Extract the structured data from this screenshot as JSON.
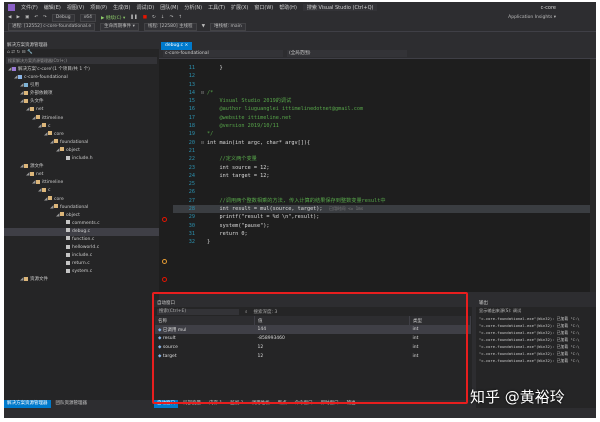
{
  "menubar": {
    "items": [
      "文件(F)",
      "编辑(E)",
      "视图(V)",
      "项目(P)",
      "生成(B)",
      "调试(D)",
      "团队(M)",
      "分析(N)",
      "工具(T)",
      "扩展(X)",
      "窗口(W)",
      "帮助(H)",
      "搜索 Visual Studio (Ctrl+Q)"
    ],
    "title": "c-core"
  },
  "toolbar": {
    "mode": "Debug",
    "platform": "x64",
    "start_label": "▶ 继续(C) ▾",
    "right_label": "Application Insights ▾",
    "process": "进程: [12552] c-core-foundational.e",
    "lifecycle": "生命周期事件 ▾",
    "thread": "线程: [22580] 主线程",
    "stack": "堆栈帧: main"
  },
  "solution_explorer": {
    "title": "解决方案资源管理器",
    "search_placeholder": "搜索解决方案资源管理器(Ctrl+;)",
    "tree": [
      {
        "label": "解决方案'c-core'(1 个项目/共 1 个)",
        "depth": 0,
        "icon": "sol"
      },
      {
        "label": "c-core-foundational",
        "depth": 1,
        "icon": "proj"
      },
      {
        "label": "引用",
        "depth": 2,
        "icon": "ref"
      },
      {
        "label": "外部依赖项",
        "depth": 2,
        "icon": "folder"
      },
      {
        "label": "头文件",
        "depth": 2,
        "icon": "folder"
      },
      {
        "label": "net",
        "depth": 3,
        "icon": "folder"
      },
      {
        "label": "ittimeline",
        "depth": 4,
        "icon": "folder"
      },
      {
        "label": "c",
        "depth": 5,
        "icon": "folder"
      },
      {
        "label": "core",
        "depth": 6,
        "icon": "folder"
      },
      {
        "label": "foundational",
        "depth": 7,
        "icon": "folder"
      },
      {
        "label": "object",
        "depth": 8,
        "icon": "folder"
      },
      {
        "label": "include.h",
        "depth": 9,
        "icon": "file"
      },
      {
        "label": "源文件",
        "depth": 2,
        "icon": "folder"
      },
      {
        "label": "net",
        "depth": 3,
        "icon": "folder"
      },
      {
        "label": "ittimeline",
        "depth": 4,
        "icon": "folder"
      },
      {
        "label": "c",
        "depth": 5,
        "icon": "folder"
      },
      {
        "label": "core",
        "depth": 6,
        "icon": "folder"
      },
      {
        "label": "foundational",
        "depth": 7,
        "icon": "folder"
      },
      {
        "label": "object",
        "depth": 8,
        "icon": "folder"
      },
      {
        "label": "comments.c",
        "depth": 9,
        "icon": "file"
      },
      {
        "label": "debug.c",
        "depth": 9,
        "icon": "file"
      },
      {
        "label": "function.c",
        "depth": 9,
        "icon": "file"
      },
      {
        "label": "helloworld.c",
        "depth": 9,
        "icon": "file"
      },
      {
        "label": "include.c",
        "depth": 9,
        "icon": "file"
      },
      {
        "label": "return.c",
        "depth": 9,
        "icon": "file"
      },
      {
        "label": "system.c",
        "depth": 9,
        "icon": "file"
      },
      {
        "label": "资源文件",
        "depth": 2,
        "icon": "folder"
      }
    ],
    "bottom_tabs": [
      "解决方案资源管理器",
      "团队资源管理器"
    ]
  },
  "editor": {
    "tab": "debug.c",
    "nav_left": "c-core-foundational",
    "nav_mid": "(全局范围)",
    "lines": [
      {
        "n": "11",
        "text": "    }",
        "cls": "tx"
      },
      {
        "n": "12",
        "text": "",
        "cls": "tx"
      },
      {
        "n": "13",
        "text": "",
        "cls": "tx"
      },
      {
        "n": "14",
        "text": "/*",
        "cls": "cm"
      },
      {
        "n": "15",
        "text": "    Visual Studio 2019的调试",
        "cls": "cm"
      },
      {
        "n": "16",
        "text": "    @author liuguanglei ittimelinedotnet@gmail.com",
        "cls": "cm"
      },
      {
        "n": "17",
        "text": "    @website ittimeline.net",
        "cls": "cm"
      },
      {
        "n": "18",
        "text": "    @version 2019/10/11",
        "cls": "cm"
      },
      {
        "n": "19",
        "text": "*/",
        "cls": "cm"
      },
      {
        "n": "20",
        "text": "int main(int argc, char* argv[]){",
        "cls": "tx"
      },
      {
        "n": "21",
        "text": "",
        "cls": "tx"
      },
      {
        "n": "22",
        "text": "    //定义两个变量",
        "cls": "cm"
      },
      {
        "n": "23",
        "text": "    int source = 12;",
        "cls": "tx"
      },
      {
        "n": "24",
        "text": "    int target = 12;",
        "cls": "tx"
      },
      {
        "n": "25",
        "text": "",
        "cls": "tx"
      },
      {
        "n": "26",
        "text": "",
        "cls": "tx"
      },
      {
        "n": "27",
        "text": "    //调用两个整数相乘的方法, 传入计算的结果保存到整数变量result中",
        "cls": "cm"
      },
      {
        "n": "28",
        "text": "    int result = mul(source, target);",
        "cls": "tx"
      },
      {
        "n": "29",
        "text": "    printf(\"result = %d \\n\",result);",
        "cls": "tx"
      },
      {
        "n": "30",
        "text": "    system(\"pause\");",
        "cls": "tx"
      },
      {
        "n": "31",
        "text": "    return 0;",
        "cls": "tx"
      },
      {
        "n": "32",
        "text": "}",
        "cls": "tx"
      }
    ],
    "inline_hint": "已用时间 <= 1ms"
  },
  "locals": {
    "title": "自动窗口",
    "search_placeholder": "搜索(Ctrl+E)",
    "depth_label": "搜索深度: 3",
    "columns": [
      "名称",
      "值",
      "类型"
    ],
    "rows": [
      {
        "name": "已调用 mul",
        "value": "144",
        "type": "int"
      },
      {
        "name": "result",
        "value": "-858993460",
        "type": "int"
      },
      {
        "name": "source",
        "value": "12",
        "type": "int"
      },
      {
        "name": "target",
        "value": "12",
        "type": "int"
      }
    ],
    "bottom_tabs": [
      "自动窗口",
      "局部变量",
      "内存 1",
      "监视 1",
      "调用堆栈",
      "断点",
      "命令窗口",
      "即时窗口",
      "输出"
    ]
  },
  "output": {
    "title": "输出",
    "source_label": "显示输出来源(S): 调试",
    "lines": [
      "\"c-core-foundational.exe\"(Win32): 已加载 \"C:\\",
      "\"c-core-foundational.exe\"(Win32): 已加载 \"C:\\",
      "\"c-core-foundational.exe\"(Win32): 已加载 \"C:\\",
      "\"c-core-foundational.exe\"(Win32): 已加载 \"C:\\",
      "\"c-core-foundational.exe\"(Win32): 已加载 \"C:\\",
      "\"c-core-foundational.exe\"(Win32): 已加载 \"C:\\",
      "\"c-core-foundational.exe\"(Win32): 已加载 \"C:\\"
    ]
  },
  "watermark": "知乎 @黄裕玲"
}
